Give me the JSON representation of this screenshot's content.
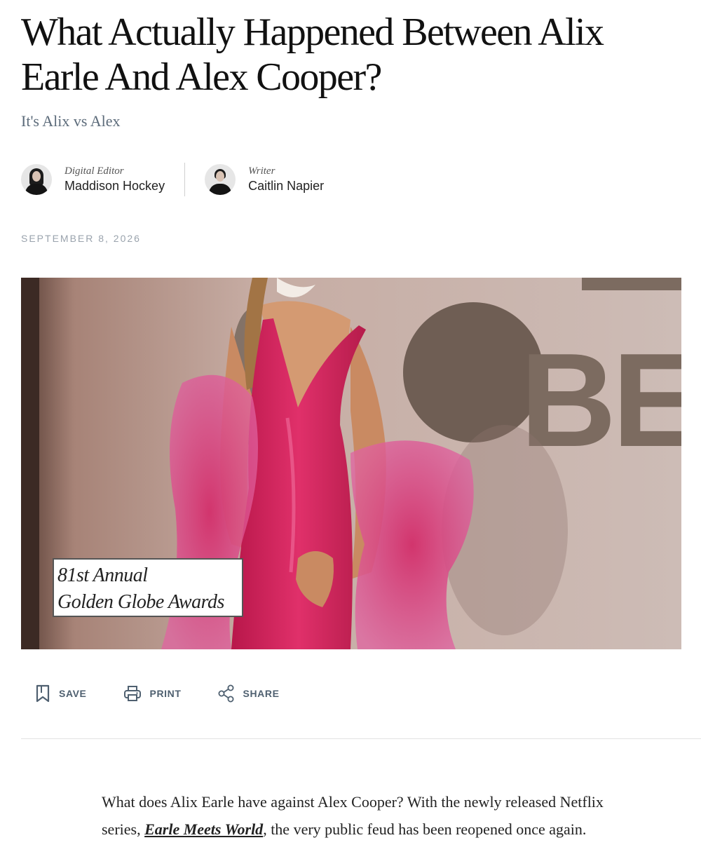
{
  "article": {
    "headline": "What Actually Happened Between Alix Earle And Alex Cooper?",
    "dek": "It's Alix vs Alex",
    "date": "SEPTEMBER 8, 2026"
  },
  "bylines": [
    {
      "role": "Digital Editor",
      "name": "Maddison Hockey"
    },
    {
      "role": "Writer",
      "name": "Caitlin Napier"
    }
  ],
  "hero": {
    "caption_line1": "81st Annual",
    "caption_line2": "Golden Globe Awards",
    "backdrop_letters": "OBES"
  },
  "actions": {
    "save": "SAVE",
    "print": "PRINT",
    "share": "SHARE"
  },
  "body": {
    "p1_before": "What does Alix Earle have against Alex Cooper? With the newly released Netflix series, ",
    "p1_link": "Earle Meets World",
    "p1_after": ", the very public feud has been reopened once again."
  },
  "colors": {
    "dek": "#5c6b7a",
    "action": "#4f6070",
    "dress": "#d6245e",
    "backdrop": "#c7b3ad"
  }
}
